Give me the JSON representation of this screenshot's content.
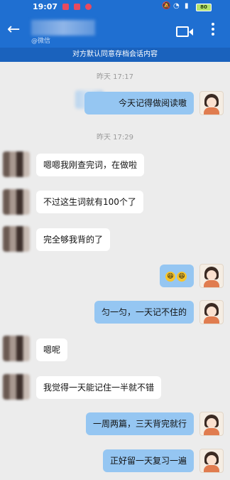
{
  "status_bar": {
    "time": "19:07",
    "battery": "80"
  },
  "header": {
    "contact_subtitle": "@微信",
    "notice": "对方默认同意存档会话内容"
  },
  "messages": [
    {
      "type": "timestamp",
      "text": "昨天 17:17"
    },
    {
      "type": "me",
      "text": "今天记得做阅读嗷"
    },
    {
      "type": "timestamp",
      "text": "昨天 17:29"
    },
    {
      "type": "other",
      "text": "嗯嗯我刚查完词，在做啦"
    },
    {
      "type": "other",
      "text": "不过这生词就有100个了"
    },
    {
      "type": "other",
      "text": "完全够我背的了"
    },
    {
      "type": "me",
      "text": "",
      "emoji": [
        "emoji-grin",
        "emoji-grin"
      ]
    },
    {
      "type": "me",
      "text": "匀一匀，一天记不住的"
    },
    {
      "type": "other",
      "text": "嗯呢"
    },
    {
      "type": "other",
      "text": "我觉得一天能记住一半就不错"
    },
    {
      "type": "me",
      "text": "一周两篇，三天背完就行"
    },
    {
      "type": "me",
      "text": "正好留一天复习一遍"
    }
  ],
  "colors": {
    "brand": "#1f6fd1",
    "my_bubble": "#95c6f2",
    "other_bubble": "#ffffff",
    "background": "#ececec"
  }
}
